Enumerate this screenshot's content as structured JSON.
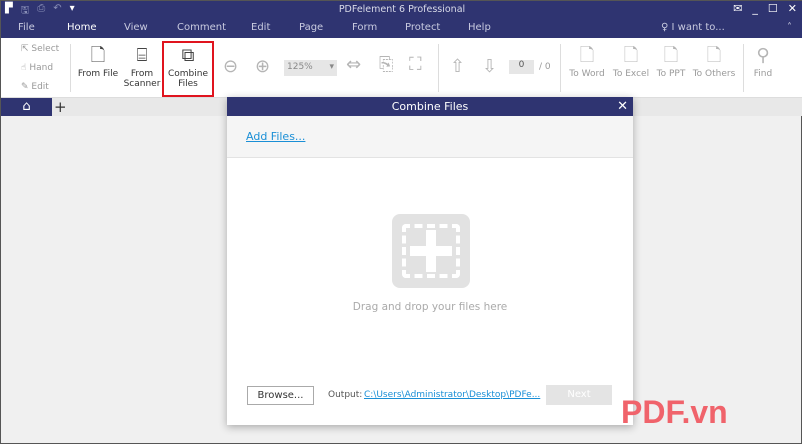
{
  "app": {
    "title": "PDFelement 6 Professional"
  },
  "menu": {
    "items": [
      "File",
      "Home",
      "View",
      "Comment",
      "Edit",
      "Page",
      "Form",
      "Protect",
      "Help"
    ],
    "active": "Home",
    "i_want_to": "I want to..."
  },
  "toolbar": {
    "select": "Select",
    "hand": "Hand",
    "edit": "Edit",
    "from_file": "From File",
    "from_scanner_1": "From",
    "from_scanner_2": "Scanner",
    "combine_1": "Combine",
    "combine_2": "Files",
    "zoom": "125%",
    "page_current": "0",
    "page_total": "/ 0",
    "to_word": "To Word",
    "to_excel": "To Excel",
    "to_ppt": "To PPT",
    "to_others": "To Others",
    "find": "Find"
  },
  "dialog": {
    "title": "Combine Files",
    "add_files": "Add Files...",
    "drop_text": "Drag and drop your files here",
    "browse": "Browse...",
    "output_label": "Output:",
    "output_path": "C:\\Users\\Administrator\\Desktop\\PDFe...",
    "next": "Next"
  },
  "watermark": "PDF.vn",
  "colors": {
    "nav": "#2f3471",
    "highlight": "#e0141e",
    "link": "#1a8fd6"
  }
}
